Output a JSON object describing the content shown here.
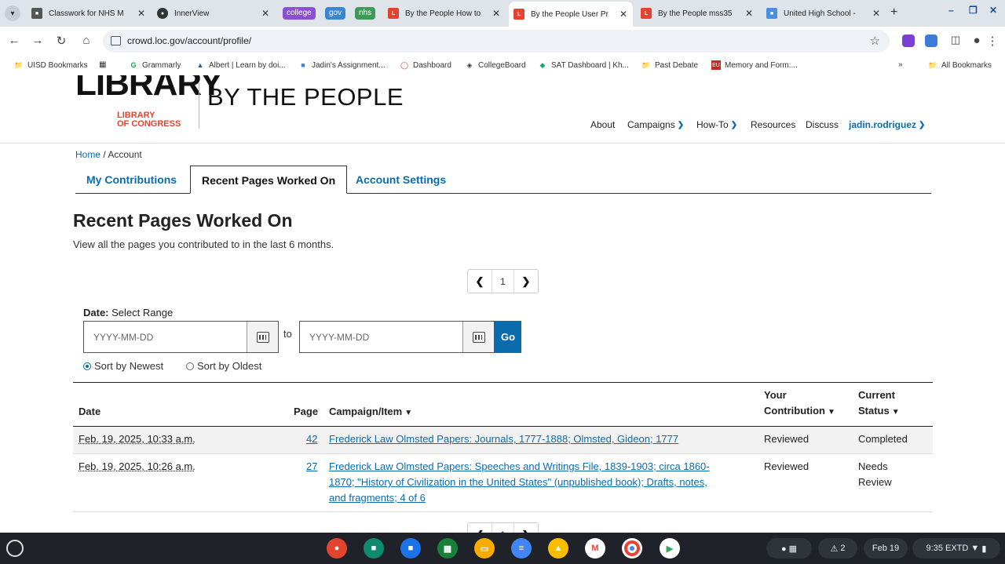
{
  "browser": {
    "tabs": [
      {
        "title": "Classwork for NHS M",
        "favicon_color": "#555"
      },
      {
        "title": "InnerView",
        "favicon_color": "#333"
      },
      {
        "title": "By the People How to",
        "favicon_color": "#e2442f"
      },
      {
        "title": "By the People User Pr",
        "favicon_color": "#e2442f"
      },
      {
        "title": "By the People mss35",
        "favicon_color": "#e2442f"
      },
      {
        "title": "United High School -",
        "favicon_color": "#4a8fe0"
      }
    ],
    "tab_groups": [
      {
        "label": "college",
        "color": "#8a4fd6"
      },
      {
        "label": "gov",
        "color": "#3a86d4"
      },
      {
        "label": "nhs",
        "color": "#3f9a5a"
      }
    ],
    "url": "crowd.loc.gov/account/profile/",
    "bookmarks": [
      "UISD Bookmarks",
      "Grammarly",
      "Albert | Learn by doi...",
      "Jadin's Assignment...",
      "Dashboard",
      "CollegeBoard",
      "SAT Dashboard | Kh...",
      "Past Debate",
      "Memory and Form:...",
      "All Bookmarks"
    ]
  },
  "site": {
    "logo_main": "LIBRARY",
    "logo_sub_line1": "LIBRARY",
    "logo_sub_line2": "OF CONGRESS",
    "title": "BY THE PEOPLE",
    "nav": {
      "about": "About",
      "campaigns": "Campaigns",
      "howto": "How-To",
      "resources": "Resources",
      "discuss": "Discuss",
      "user": "jadin.rodriguez"
    }
  },
  "breadcrumb": {
    "home": "Home",
    "sep": "/",
    "current": "Account"
  },
  "tabs": {
    "contributions": "My Contributions",
    "recent": "Recent Pages Worked On",
    "settings": "Account Settings"
  },
  "heading": "Recent Pages Worked On",
  "lead": "View all the pages you contributed to in the last 6 months.",
  "pager": {
    "page": "1"
  },
  "filter": {
    "date_label": "Date:",
    "date_hint": "Select Range",
    "from_placeholder": "YYYY-MM-DD",
    "to_label": "to",
    "to_placeholder": "YYYY-MM-DD",
    "go": "Go",
    "sort_newest": "Sort by Newest",
    "sort_oldest": "Sort by Oldest"
  },
  "table": {
    "headers": {
      "date": "Date",
      "page": "Page",
      "campaign": "Campaign/Item",
      "contribution_1": "Your",
      "contribution_2": "Contribution",
      "status_1": "Current",
      "status_2": "Status"
    },
    "rows": [
      {
        "date": "Feb. 19, 2025, 10:33 a.m.",
        "page": "42",
        "item_lines": [
          "Frederick Law Olmsted Papers: Journals, 1777-1888; Olmsted, Gideon; 1777"
        ],
        "contribution": "Reviewed",
        "status_lines": [
          "Completed"
        ]
      },
      {
        "date": "Feb. 19, 2025, 10:26 a.m.",
        "page": "27",
        "item_lines": [
          "Frederick Law Olmsted Papers: Speeches and Writings File, 1839-1903; circa 1860-",
          "1870; \"History of Civilization in the United States\" (unpublished book); Drafts, notes,",
          "and fragments; 4 of 6"
        ],
        "contribution": "Reviewed",
        "status_lines": [
          "Needs",
          "Review"
        ]
      }
    ]
  },
  "shelf": {
    "date": "Feb 19",
    "time": "9:35 EXTD",
    "notifications": "2"
  }
}
